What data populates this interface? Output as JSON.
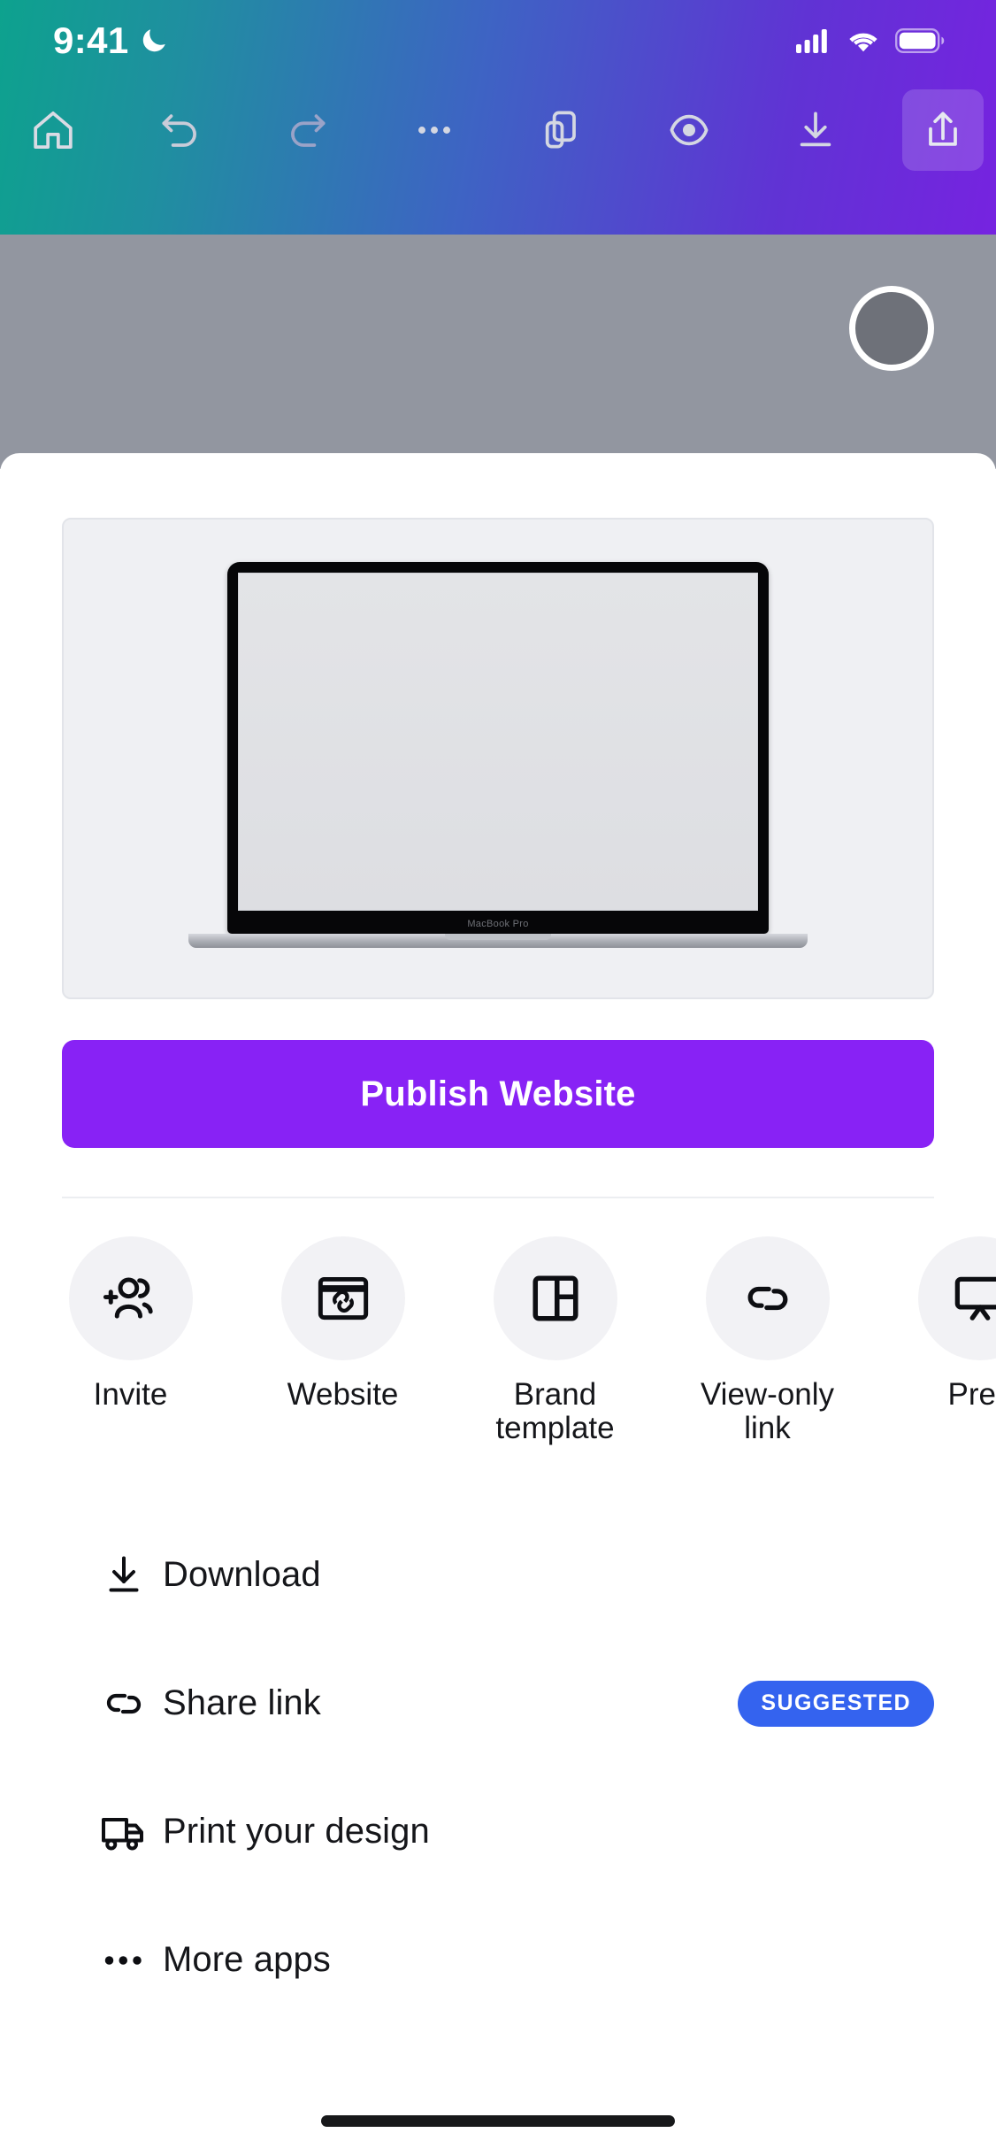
{
  "status_bar": {
    "time": "9:41",
    "dnd_icon": "crescent-moon-icon",
    "cellular_icon": "cellular-signal-icon",
    "wifi_icon": "wifi-icon",
    "battery_icon": "battery-full-icon"
  },
  "toolbar": {
    "items": [
      {
        "name": "home",
        "icon": "home-icon",
        "label": "Home",
        "active": false
      },
      {
        "name": "undo",
        "icon": "undo-arrow-icon",
        "label": "Undo",
        "active": false
      },
      {
        "name": "redo",
        "icon": "redo-arrow-icon",
        "label": "Redo",
        "active": false
      },
      {
        "name": "more",
        "icon": "ellipsis-icon",
        "label": "More",
        "active": false
      },
      {
        "name": "pages",
        "icon": "pages-copy-icon",
        "label": "Pages",
        "active": false
      },
      {
        "name": "preview",
        "icon": "eye-icon",
        "label": "Preview",
        "active": false
      },
      {
        "name": "download",
        "icon": "download-arrow-icon",
        "label": "Download",
        "active": false
      },
      {
        "name": "share",
        "icon": "share-up-arrow-icon",
        "label": "Share",
        "active": true
      }
    ]
  },
  "canvas": {
    "avatar_icon": "avatar-circle"
  },
  "preview": {
    "device": "laptop-mockup",
    "device_brand": "MacBook Pro"
  },
  "cta": {
    "label": "Publish Website"
  },
  "quick_actions": [
    {
      "label": "Invite",
      "icon": "add-people-icon"
    },
    {
      "label": "Website",
      "icon": "browser-link-icon"
    },
    {
      "label": "Brand\ntemplate",
      "icon": "layout-template-icon"
    },
    {
      "label": "View-only\nlink",
      "icon": "chain-link-icon"
    },
    {
      "label": "Pres",
      "icon": "present-screen-icon"
    }
  ],
  "list_items": [
    {
      "label": "Download",
      "icon": "download-arrow-icon",
      "badge": ""
    },
    {
      "label": "Share link",
      "icon": "chain-link-icon",
      "badge": "SUGGESTED"
    },
    {
      "label": "Print your design",
      "icon": "delivery-truck-icon",
      "badge": ""
    },
    {
      "label": "More apps",
      "icon": "ellipsis-icon",
      "badge": ""
    }
  ],
  "colors": {
    "cta_purple": "#8822f5",
    "badge_blue": "#3463ef",
    "canvas_grey": "#9296a0",
    "quick_circle": "#f2f2f5"
  }
}
